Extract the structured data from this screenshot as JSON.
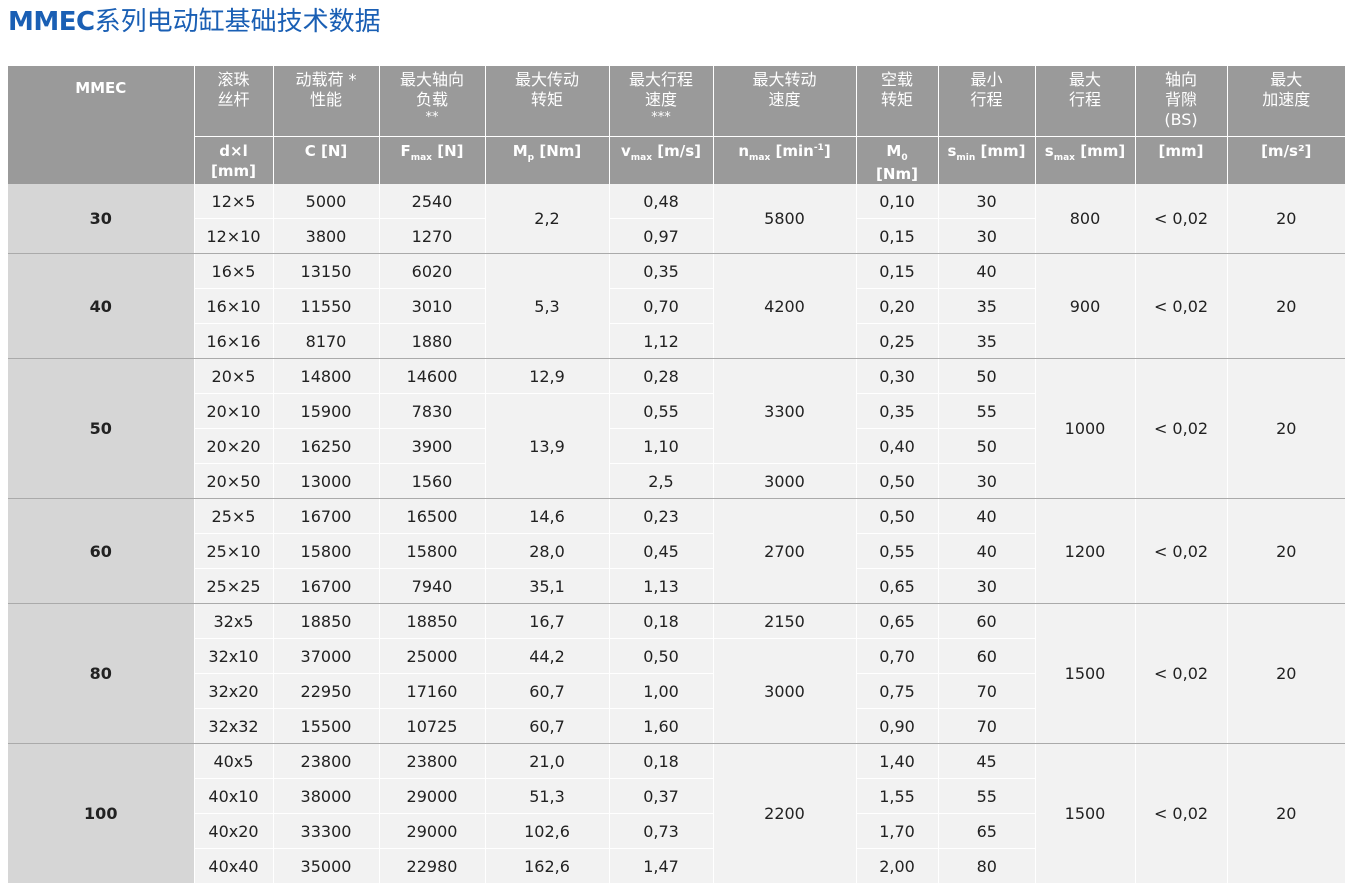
{
  "title": {
    "brand": "MMEC",
    "text": "系列电动缸基础技术数据"
  },
  "header": {
    "c1": {
      "name": "MMEC"
    },
    "c2": {
      "lines": [
        "滚珠",
        "丝杆"
      ],
      "unit": "d×l",
      "unit2": "[mm]"
    },
    "c3": {
      "lines": [
        "动载荷 *",
        "性能"
      ],
      "unit": "C [N]"
    },
    "c4": {
      "lines": [
        "最大轴向",
        "负载"
      ],
      "note": "**",
      "unit_main": "F",
      "unit_sub": "max",
      "unit_rest": " [N]"
    },
    "c5": {
      "lines": [
        "最大传动",
        "转矩"
      ],
      "unit_main": "M",
      "unit_sub": "p",
      "unit_rest": " [Nm]"
    },
    "c6": {
      "lines": [
        "最大行程",
        "速度"
      ],
      "note": "***",
      "unit_main": "v",
      "unit_sub": "max",
      "unit_rest": " [m/s]"
    },
    "c7": {
      "lines": [
        "最大转动",
        "速度"
      ],
      "unit_main": "n",
      "unit_sub": "max",
      "unit_rest": " [min",
      "unit_sup": "-1",
      "unit_end": "]"
    },
    "c8": {
      "lines": [
        "空载",
        "转矩"
      ],
      "unit_main": "M",
      "unit_sub": "0",
      "unit2": "[Nm]"
    },
    "c9": {
      "lines": [
        "最小",
        "行程"
      ],
      "unit_main": "s",
      "unit_sub": "min",
      "unit_rest": " [mm]"
    },
    "c10": {
      "lines": [
        "最大",
        "行程"
      ],
      "unit_main": "s",
      "unit_sub": "max",
      "unit_rest": " [mm]"
    },
    "c11": {
      "lines": [
        "轴向",
        "背隙",
        "(BS)"
      ],
      "unit": "[mm]"
    },
    "c12": {
      "lines": [
        "最大",
        "加速度"
      ],
      "unit": "[m/s²]"
    }
  },
  "groups": [
    {
      "size": "30",
      "stroke": "800",
      "backlash": "< 0,02",
      "accel": "20",
      "rows": [
        {
          "screw": "12×5",
          "c": "5000",
          "fmax": "2540",
          "vmax": "0,48",
          "m0": "0,10",
          "smin": "30"
        },
        {
          "screw": "12×10",
          "c": "3800",
          "fmax": "1270",
          "vmax": "0,97",
          "m0": "0,15",
          "smin": "30"
        }
      ],
      "mp": [
        "2,2"
      ],
      "nmax": [
        "5800"
      ]
    },
    {
      "size": "40",
      "stroke": "900",
      "backlash": "< 0,02",
      "accel": "20",
      "rows": [
        {
          "screw": "16×5",
          "c": "13150",
          "fmax": "6020",
          "vmax": "0,35",
          "m0": "0,15",
          "smin": "40"
        },
        {
          "screw": "16×10",
          "c": "11550",
          "fmax": "3010",
          "vmax": "0,70",
          "m0": "0,20",
          "smin": "35"
        },
        {
          "screw": "16×16",
          "c": "8170",
          "fmax": "1880",
          "vmax": "1,12",
          "m0": "0,25",
          "smin": "35"
        }
      ],
      "mp": [
        "5,3"
      ],
      "nmax": [
        "4200"
      ]
    },
    {
      "size": "50",
      "stroke": "1000",
      "backlash": "< 0,02",
      "accel": "20",
      "rows": [
        {
          "screw": "20×5",
          "c": "14800",
          "fmax": "14600",
          "vmax": "0,28",
          "m0": "0,30",
          "smin": "50"
        },
        {
          "screw": "20×10",
          "c": "15900",
          "fmax": "7830",
          "vmax": "0,55",
          "m0": "0,35",
          "smin": "55"
        },
        {
          "screw": "20×20",
          "c": "16250",
          "fmax": "3900",
          "vmax": "1,10",
          "m0": "0,40",
          "smin": "50"
        },
        {
          "screw": "20×50",
          "c": "13000",
          "fmax": "1560",
          "vmax": "2,5",
          "m0": "0,50",
          "smin": "30"
        }
      ],
      "mp": [
        "12,9",
        "13,9"
      ],
      "nmax": [
        "3300",
        "3000"
      ]
    },
    {
      "size": "60",
      "stroke": "1200",
      "backlash": "< 0,02",
      "accel": "20",
      "rows": [
        {
          "screw": "25×5",
          "c": "16700",
          "fmax": "16500",
          "mp": "14,6",
          "vmax": "0,23",
          "m0": "0,50",
          "smin": "40"
        },
        {
          "screw": "25×10",
          "c": "15800",
          "fmax": "15800",
          "mp": "28,0",
          "vmax": "0,45",
          "m0": "0,55",
          "smin": "40"
        },
        {
          "screw": "25×25",
          "c": "16700",
          "fmax": "7940",
          "mp": "35,1",
          "vmax": "1,13",
          "m0": "0,65",
          "smin": "30"
        }
      ],
      "nmax": [
        "2700"
      ]
    },
    {
      "size": "80",
      "stroke": "1500",
      "backlash": "< 0,02",
      "accel": "20",
      "rows": [
        {
          "screw": "32x5",
          "c": "18850",
          "fmax": "18850",
          "mp": "16,7",
          "vmax": "0,18",
          "m0": "0,65",
          "smin": "60"
        },
        {
          "screw": "32x10",
          "c": "37000",
          "fmax": "25000",
          "mp": "44,2",
          "vmax": "0,50",
          "m0": "0,70",
          "smin": "60"
        },
        {
          "screw": "32x20",
          "c": "22950",
          "fmax": "17160",
          "mp": "60,7",
          "vmax": "1,00",
          "m0": "0,75",
          "smin": "70"
        },
        {
          "screw": "32x32",
          "c": "15500",
          "fmax": "10725",
          "mp": "60,7",
          "vmax": "1,60",
          "m0": "0,90",
          "smin": "70"
        }
      ],
      "nmax": [
        "2150",
        "3000"
      ]
    },
    {
      "size": "100",
      "stroke": "1500",
      "backlash": "< 0,02",
      "accel": "20",
      "rows": [
        {
          "screw": "40x5",
          "c": "23800",
          "fmax": "23800",
          "mp": "21,0",
          "vmax": "0,18",
          "m0": "1,40",
          "smin": "45"
        },
        {
          "screw": "40x10",
          "c": "38000",
          "fmax": "29000",
          "mp": "51,3",
          "vmax": "0,37",
          "m0": "1,55",
          "smin": "55"
        },
        {
          "screw": "40x20",
          "c": "33300",
          "fmax": "29000",
          "mp": "102,6",
          "vmax": "0,73",
          "m0": "1,70",
          "smin": "65"
        },
        {
          "screw": "40x40",
          "c": "35000",
          "fmax": "22980",
          "mp": "162,6",
          "vmax": "1,47",
          "m0": "2,00",
          "smin": "80"
        }
      ],
      "nmax": [
        "2200"
      ]
    }
  ]
}
